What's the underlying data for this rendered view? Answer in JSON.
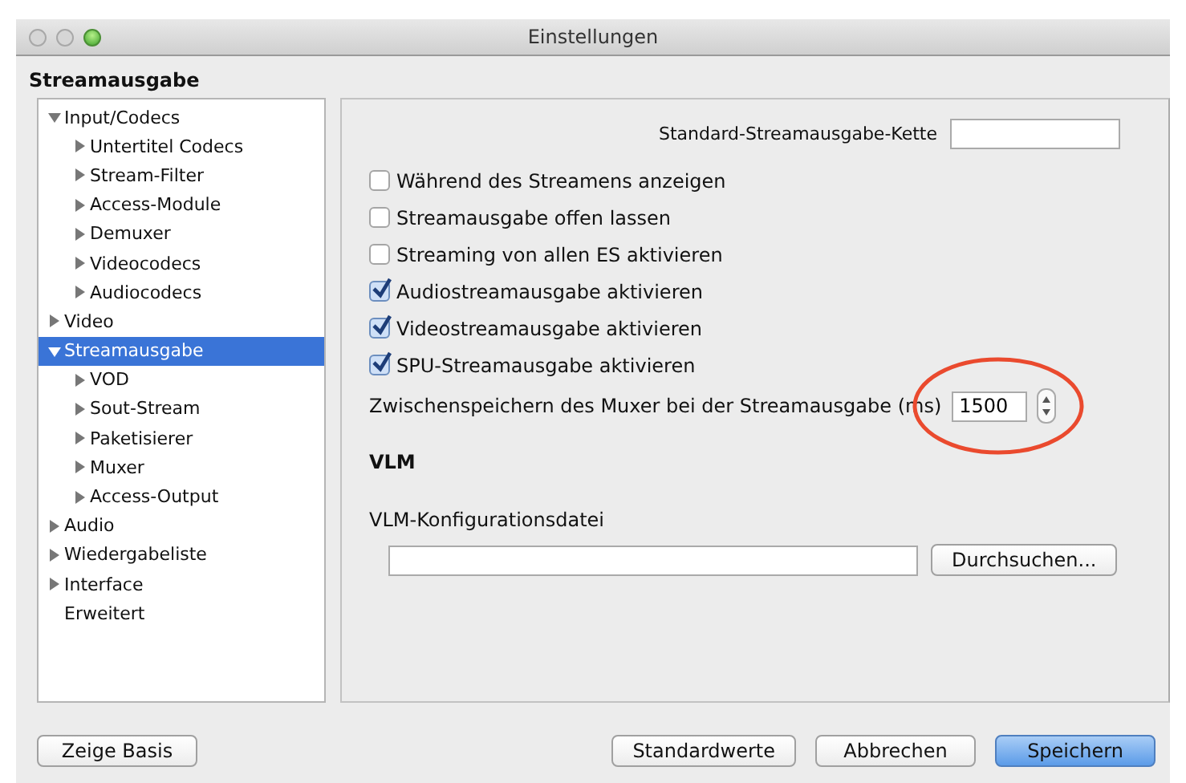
{
  "window": {
    "title": "Einstellungen"
  },
  "section_title": "Streamausgabe",
  "tree": [
    {
      "label": "Input/Codecs",
      "expanded": true,
      "selected": false,
      "children": [
        {
          "label": "Untertitel Codecs",
          "expanded": false,
          "selected": false
        },
        {
          "label": "Stream-Filter",
          "expanded": false,
          "selected": false
        },
        {
          "label": "Access-Module",
          "expanded": false,
          "selected": false
        },
        {
          "label": "Demuxer",
          "expanded": false,
          "selected": false
        },
        {
          "label": "Videocodecs",
          "expanded": false,
          "selected": false
        },
        {
          "label": "Audiocodecs",
          "expanded": false,
          "selected": false
        }
      ]
    },
    {
      "label": "Video",
      "expanded": false,
      "selected": false
    },
    {
      "label": "Streamausgabe",
      "expanded": true,
      "selected": true,
      "children": [
        {
          "label": "VOD",
          "expanded": false,
          "selected": false
        },
        {
          "label": "Sout-Stream",
          "expanded": false,
          "selected": false
        },
        {
          "label": "Paketisierer",
          "expanded": false,
          "selected": false
        },
        {
          "label": "Muxer",
          "expanded": false,
          "selected": false
        },
        {
          "label": "Access-Output",
          "expanded": false,
          "selected": false
        }
      ]
    },
    {
      "label": "Audio",
      "expanded": false,
      "selected": false
    },
    {
      "label": "Wiedergabeliste",
      "expanded": false,
      "selected": false
    },
    {
      "label": "Interface",
      "expanded": false,
      "selected": false
    },
    {
      "label": "Erweitert",
      "selected": false
    }
  ],
  "chain_field": {
    "label": "Standard-Streamausgabe-Kette"
  },
  "checkboxes": [
    {
      "label": "Während des Streamens anzeigen",
      "checked": false
    },
    {
      "label": "Streamausgabe offen lassen",
      "checked": false
    },
    {
      "label": "Streaming von allen ES aktivieren",
      "checked": false
    },
    {
      "label": "Audiostreamausgabe aktivieren",
      "checked": true
    },
    {
      "label": "Videostreamausgabe aktivieren",
      "checked": true
    },
    {
      "label": "SPU-Streamausgabe aktivieren",
      "checked": true
    }
  ],
  "mux_caching": {
    "label": "Zwischenspeichern des Muxer bei der Streamausgabe (ms)",
    "value": "1500",
    "annotation": {
      "kind": "ellipse",
      "color": "#ea4a2e"
    }
  },
  "vlm": {
    "heading": "VLM",
    "file_label": "VLM-Konfigurationsdatei",
    "browse_button": "Durchsuchen..."
  },
  "buttons": [
    {
      "label": "Zeige Basis",
      "kind": "left",
      "default": false
    },
    {
      "label": "Standardwerte",
      "kind": "right",
      "default": false
    },
    {
      "label": "Abbrechen",
      "kind": "right",
      "default": false
    },
    {
      "label": "Speichern",
      "kind": "right",
      "default": true
    }
  ]
}
